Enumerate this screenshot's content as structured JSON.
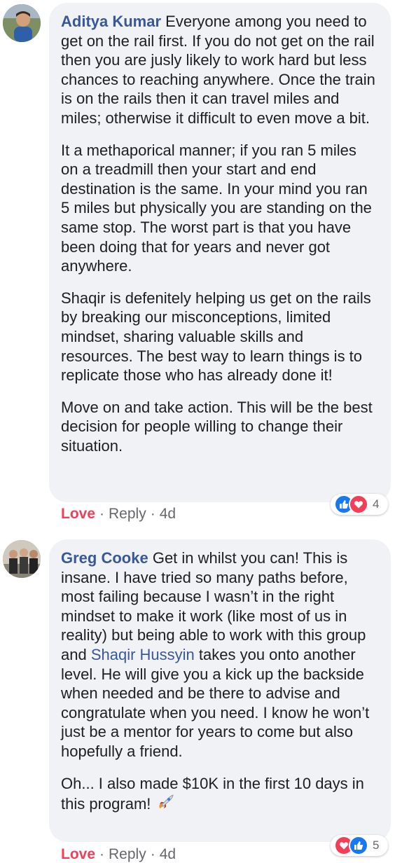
{
  "comments": [
    {
      "author": "Aditya Kumar",
      "paragraphs": [
        "Everyone among you need to get on the rail first. If you do not get on the rail then you are jusly likely to work hard but less chances to reaching anywhere. Once the train is on the rails then it can travel miles and miles; otherwise it difficult to even move a bit.",
        "It a methaporical manner; if you ran 5 miles on a treadmill then your start and end destination is the same. In your mind you ran 5 miles but physically you are standing on the same stop. The worst part is that you have been doing that for years and never got anywhere.",
        "Shaqir is defenitely helping us get on the rails by breaking our misconceptions, limited mindset, sharing valuable skills and resources. The best way to learn things is to replicate those who has already done it!",
        "Move on and take action. This will be the best decision for people willing to change their situation."
      ],
      "actions": {
        "love": "Love",
        "reply": "Reply",
        "time": "4d",
        "dot": "·"
      },
      "reaction_count": "4",
      "reaction_icons": [
        "like-icon",
        "love-icon"
      ]
    },
    {
      "author": "Greg Cooke",
      "text_before_mention": "Get in whilst you can! This is insane. I have tried so many paths before, most failing because I wasn’t in the right mindset to make it work (like most of us in reality) but being able to work with this group and ",
      "mention": "Shaqir Hussyin",
      "text_after_mention": " takes you onto another level. He will give you a kick up the backside when needed and be there to advise and congratulate when you need. I know he won’t just be a mentor for years to come but also hopefully a friend.",
      "paragraph2": "Oh... I also made $10K in the first 10 days in this program! ",
      "emoji": "rocket-icon",
      "actions": {
        "love": "Love",
        "reply": "Reply",
        "time": "4d",
        "dot": "·"
      },
      "reaction_count": "5",
      "reaction_icons": [
        "love-icon",
        "like-icon"
      ]
    }
  ],
  "colors": {
    "author": "#385898",
    "bubble": "#f0f2f5",
    "love": "#f33e58",
    "like": "#1877f2",
    "meta": "#65676b"
  }
}
